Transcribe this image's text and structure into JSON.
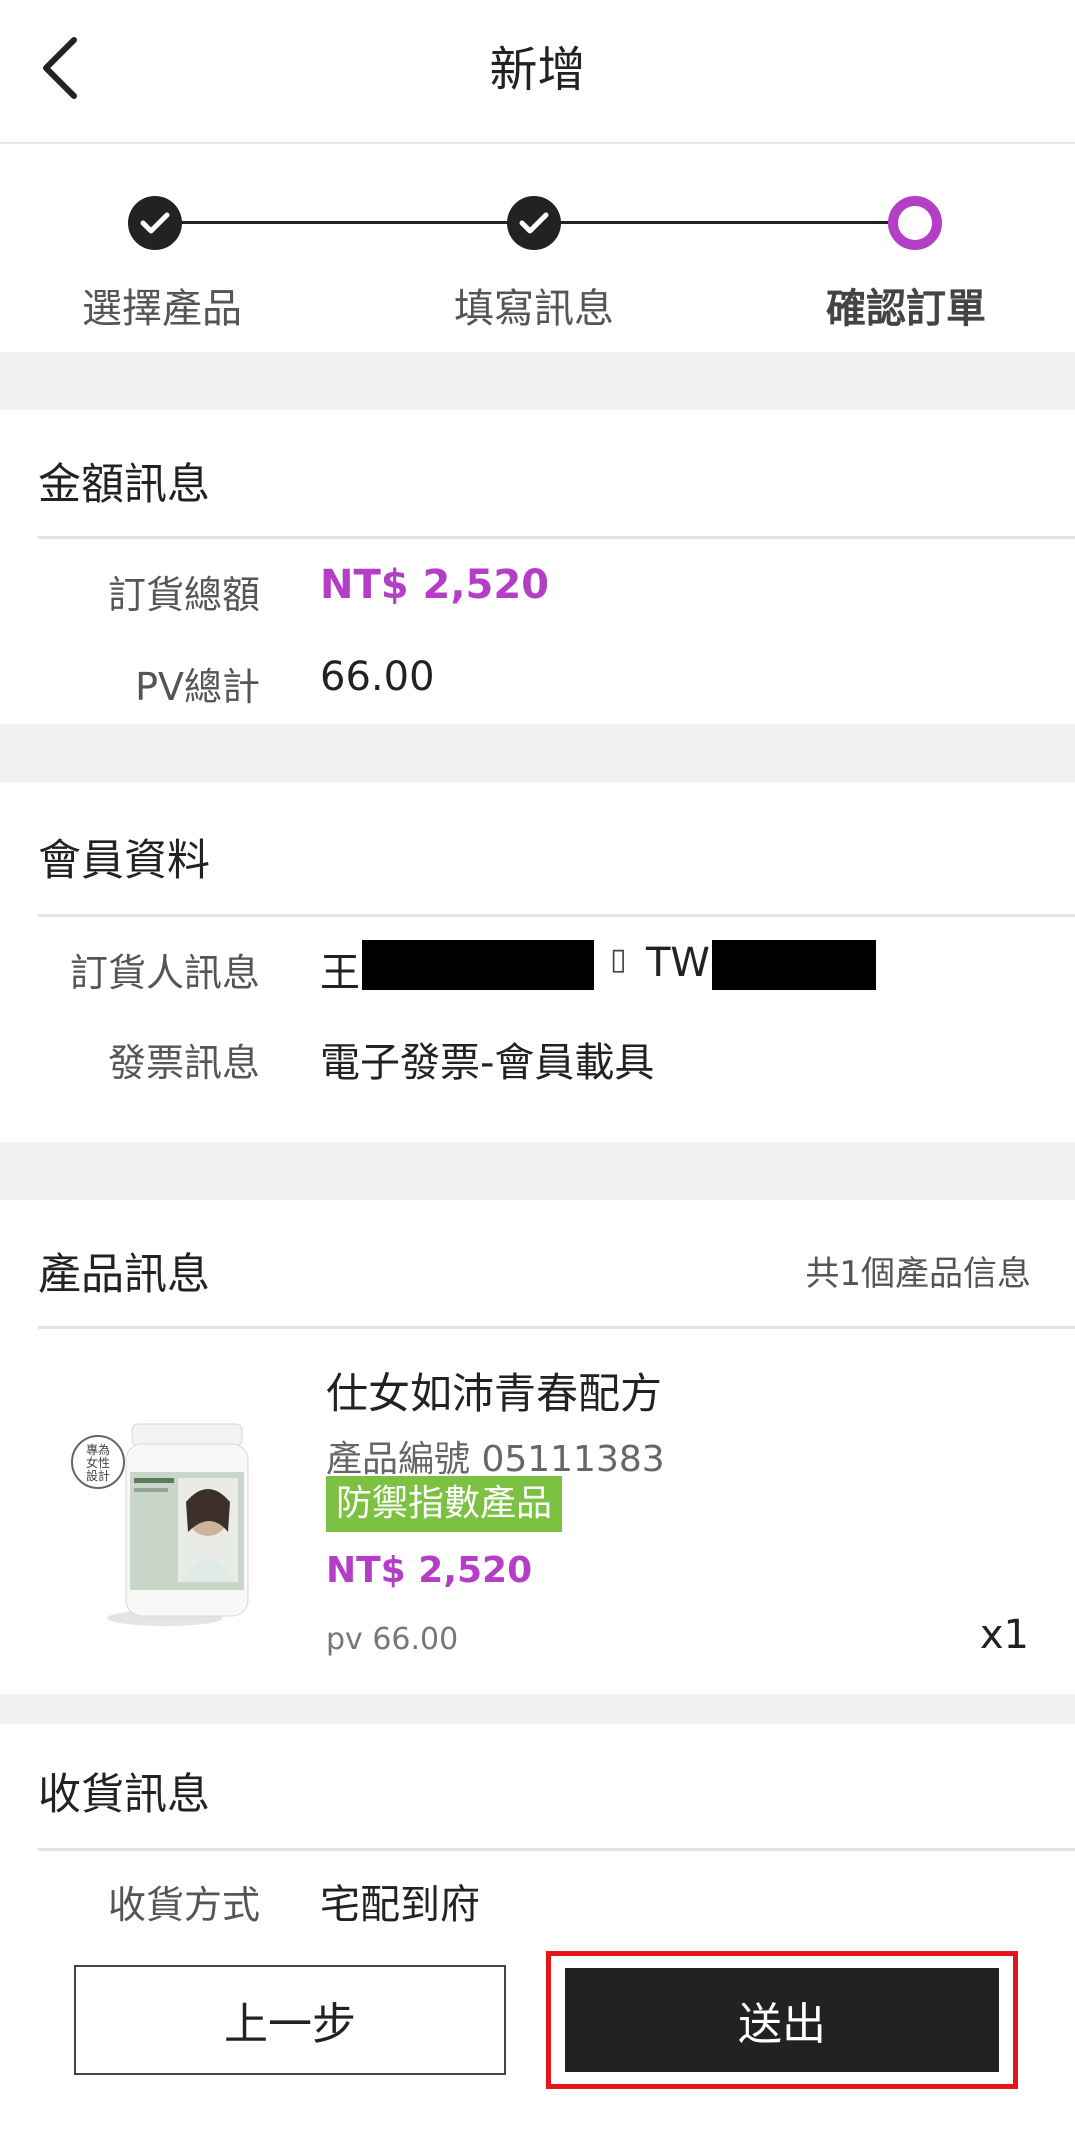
{
  "header": {
    "title": "新增"
  },
  "steps": [
    {
      "label": "選擇產品",
      "state": "done"
    },
    {
      "label": "填寫訊息",
      "state": "done"
    },
    {
      "label": "確認訂單",
      "state": "current"
    }
  ],
  "amount": {
    "title": "金額訊息",
    "total_label": "訂貨總額",
    "total_value": "NT$ 2,520",
    "pv_label": "PV總計",
    "pv_value": "66.00"
  },
  "member": {
    "title": "會員資料",
    "orderer_label": "訂貨人訊息",
    "orderer_name_prefix": "王",
    "orderer_separator": "▯",
    "orderer_id_prefix": "TW",
    "invoice_label": "發票訊息",
    "invoice_value": "電子發票-會員載具"
  },
  "products": {
    "title": "產品訊息",
    "count_text": "共1個產品信息",
    "items": [
      {
        "name": "仕女如沛青春配方",
        "code": "產品編號 05111383",
        "badge": "防禦指數產品",
        "price": "NT$ 2,520",
        "pv": "pv 66.00",
        "qty": "x1",
        "image_stamp": "專為女性設計"
      }
    ]
  },
  "shipping": {
    "title": "收貨訊息",
    "method_label": "收貨方式",
    "method_value": "宅配到府"
  },
  "footer": {
    "prev_label": "上一步",
    "submit_label": "送出"
  },
  "colors": {
    "accent": "#b43fc6",
    "badge": "#7dc142",
    "highlight": "#e8141c",
    "dark": "#222222"
  }
}
